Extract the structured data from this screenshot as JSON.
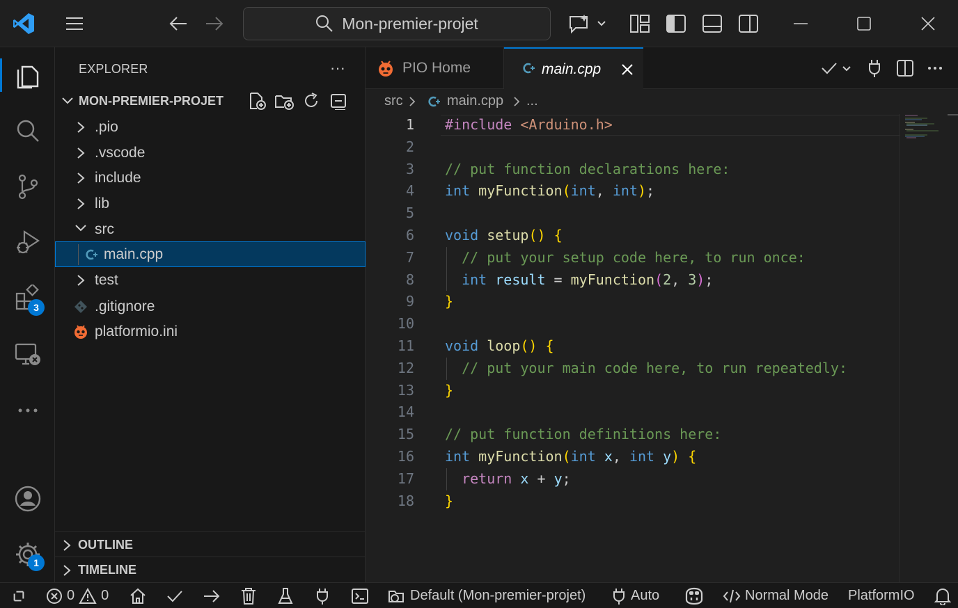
{
  "titlebar": {
    "search_text": "Mon-premier-projet"
  },
  "activitybar": {
    "extensions_badge": "3",
    "settings_badge": "1"
  },
  "sidebar": {
    "title": "EXPLORER",
    "more": "···",
    "project_name": "MON-PREMIER-PROJET",
    "tree": [
      {
        "label": ".pio"
      },
      {
        "label": ".vscode"
      },
      {
        "label": "include"
      },
      {
        "label": "lib"
      },
      {
        "label": "src"
      },
      {
        "label": "main.cpp"
      },
      {
        "label": "test"
      },
      {
        "label": ".gitignore"
      },
      {
        "label": "platformio.ini"
      }
    ],
    "sections": {
      "outline": "OUTLINE",
      "timeline": "TIMELINE"
    }
  },
  "tabs": {
    "pio_home": "PIO Home",
    "main_cpp": "main.cpp"
  },
  "breadcrumb": {
    "folder": "src",
    "file": "main.cpp",
    "more": "..."
  },
  "editor": {
    "line_numbers": [
      "1",
      "2",
      "3",
      "4",
      "5",
      "6",
      "7",
      "8",
      "9",
      "10",
      "11",
      "12",
      "13",
      "14",
      "15",
      "16",
      "17",
      "18"
    ],
    "current_line": 1
  },
  "statusbar": {
    "errors": "0",
    "warnings": "0",
    "project_env": "Default (Mon-premier-projet)",
    "port": "Auto",
    "mode": "Normal Mode",
    "platformio": "PlatformIO"
  },
  "colors": {
    "accent": "#0078d4",
    "selection_bg": "#04395e",
    "pio_orange": "#f26c34"
  }
}
